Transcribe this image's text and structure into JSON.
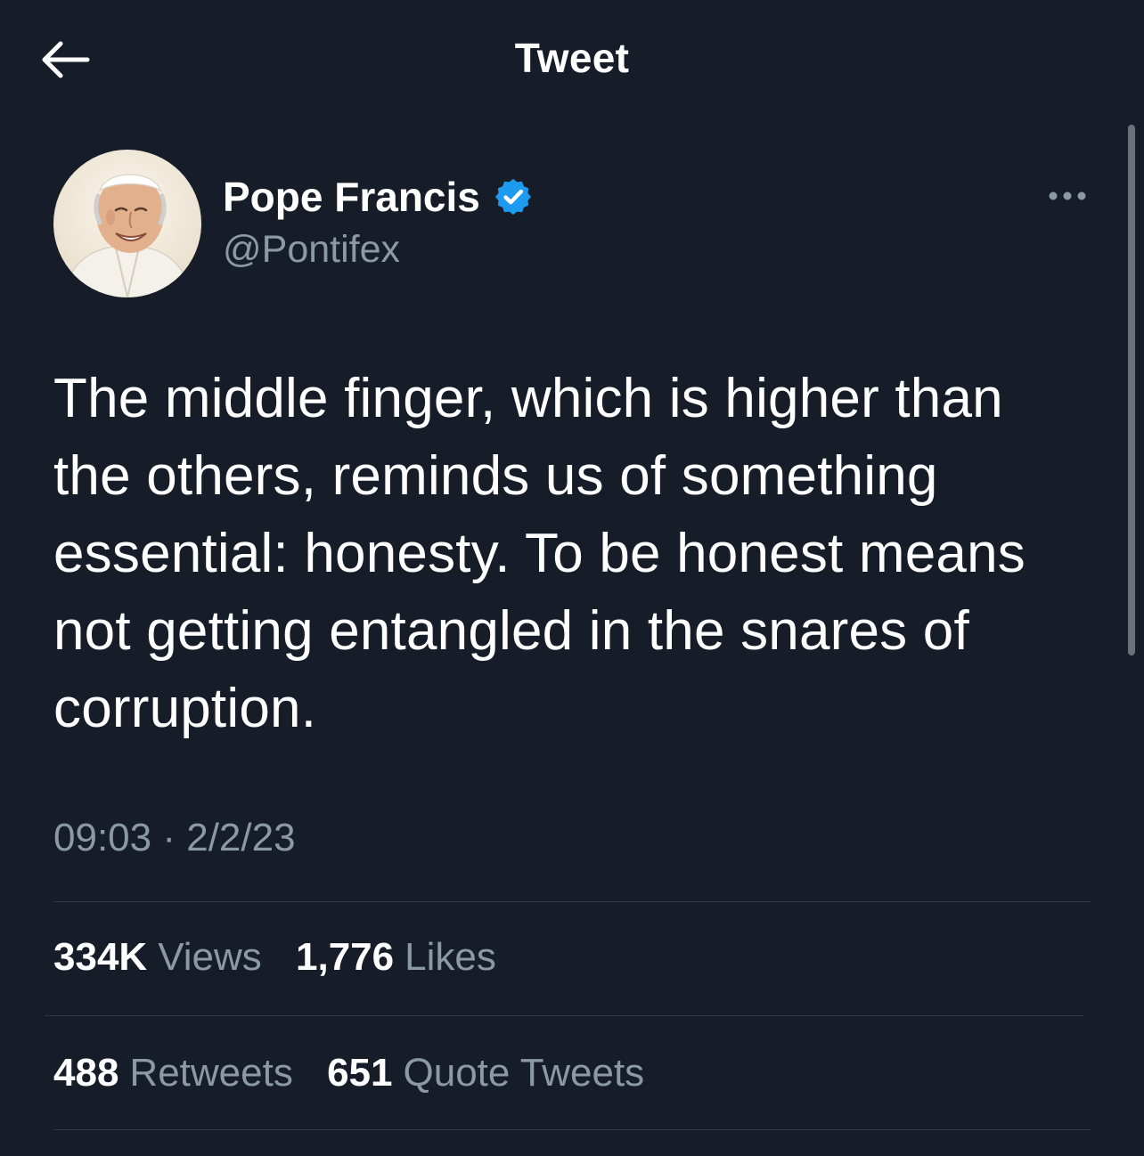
{
  "header": {
    "title": "Tweet",
    "back_icon": "arrow-left-icon"
  },
  "tweet": {
    "author": {
      "name": "Pope Francis",
      "handle": "@Pontifex",
      "verified": true,
      "verified_color": "#1d9bf0"
    },
    "text": "The middle finger, which is higher than the others, reminds us of something essential: honesty. To be honest means not getting entangled in the snares of corruption.",
    "time": "09:03",
    "date": "2/2/23",
    "separator": "·",
    "stats": {
      "views_count": "334K",
      "views_label": "Views",
      "likes_count": "1,776",
      "likes_label": "Likes",
      "retweets_count": "488",
      "retweets_label": "Retweets",
      "quotes_count": "651",
      "quotes_label": "Quote Tweets"
    }
  },
  "colors": {
    "background": "#161d28",
    "text_primary": "#ffffff",
    "text_secondary": "#8b98a5",
    "divider": "#2f3640",
    "accent": "#1d9bf0"
  }
}
